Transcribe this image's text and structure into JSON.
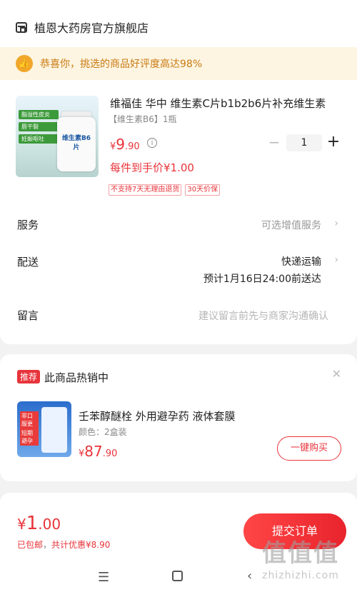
{
  "shop": {
    "name": "植恩大药房官方旗舰店"
  },
  "congrats": {
    "icon": "thumbs-up-icon",
    "text": "恭喜你，挑选的商品好评度高达98%"
  },
  "product": {
    "title": "维福佳 华中 维生素C片b1b2b6片补充维生素",
    "spec": "【维生素B6】1瓶",
    "image_tags": [
      "脂溢性皮炎",
      "唇干裂",
      "妊娠呕吐"
    ],
    "bottle_label": "维生素B6片",
    "price": {
      "currency": "¥",
      "integer": "9",
      "decimal": ".90"
    },
    "final_price_text": "每件到手价¥1.00",
    "quantity": "1",
    "badges": [
      "不支持7天无理由退货",
      "30天价保"
    ]
  },
  "rows": {
    "service": {
      "label": "服务",
      "value": "可选增值服务"
    },
    "delivery": {
      "label": "配送",
      "method": "快递运输",
      "eta": "预计1月16日24:00前送达"
    },
    "note": {
      "label": "留言",
      "placeholder": "建议留言前先与商家沟通确认"
    }
  },
  "hot": {
    "badge": "推荐",
    "title": "此商品热销中",
    "item": {
      "title": "壬苯醇醚栓 外用避孕药 液体套膜",
      "spec": "颜色：2盒装",
      "price": {
        "currency": "¥",
        "integer": "87",
        "decimal": ".90"
      },
      "buy_label": "一键购买",
      "image_labels": [
        "非口服更安心",
        "短期避孕"
      ]
    }
  },
  "footer": {
    "total": {
      "currency": "¥",
      "integer": "1",
      "decimal": ".00"
    },
    "shipping_note": "已包邮",
    "separator": "，",
    "discount_note": "共计优惠¥8.90",
    "submit_label": "提交订单"
  },
  "nav": {
    "menu": "menu-icon",
    "home": "home-icon",
    "back": "back-icon"
  },
  "watermark": {
    "big": "值值值",
    "small": "zhizhizhi.com"
  },
  "colors": {
    "accent": "#e8333a",
    "congrats_bg": "#fdf5e2",
    "congrats_text": "#c97a12"
  }
}
